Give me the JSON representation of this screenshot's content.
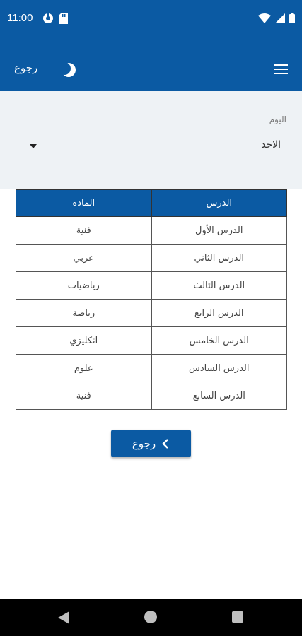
{
  "status_bar": {
    "time": "11:00"
  },
  "app_bar": {
    "back_label": "رجوع"
  },
  "filter": {
    "label": "اليوم",
    "selected_day": "الاحد"
  },
  "table": {
    "headers": {
      "lesson": "الدرس",
      "subject": "المادة"
    },
    "rows": [
      {
        "lesson": "الدرس الأول",
        "subject": "فنية"
      },
      {
        "lesson": "الدرس الثاني",
        "subject": "عربي"
      },
      {
        "lesson": "الدرس الثالث",
        "subject": "رياضيات"
      },
      {
        "lesson": "الدرس الرابع",
        "subject": "رياضة"
      },
      {
        "lesson": "الدرس الخامس",
        "subject": "انكليزي"
      },
      {
        "lesson": "الدرس السادس",
        "subject": "علوم"
      },
      {
        "lesson": "الدرس السابع",
        "subject": "فنية"
      }
    ]
  },
  "back_button": {
    "label": "رجوع"
  },
  "colors": {
    "primary": "#0b5aa3",
    "panel_bg": "#eef2f5",
    "nav_bg": "#000000"
  },
  "icons": [
    "moon-icon",
    "menu-icon",
    "chevron-left-icon",
    "wifi-icon",
    "signal-icon",
    "battery-icon"
  ]
}
